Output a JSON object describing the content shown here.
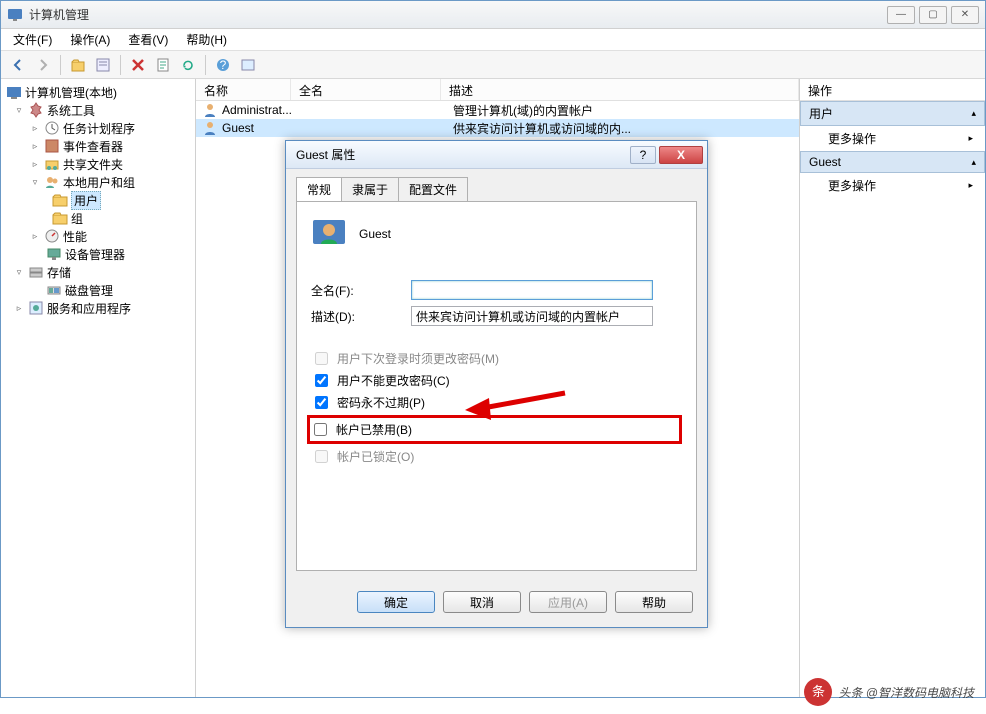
{
  "window": {
    "title": "计算机管理"
  },
  "menu": {
    "file": "文件(F)",
    "action": "操作(A)",
    "view": "查看(V)",
    "help": "帮助(H)"
  },
  "tree": {
    "root": "计算机管理(本地)",
    "sys": "系统工具",
    "sched": "任务计划程序",
    "event": "事件查看器",
    "share": "共享文件夹",
    "localusr": "本地用户和组",
    "users": "用户",
    "groups": "组",
    "perf": "性能",
    "devmgr": "设备管理器",
    "storage": "存储",
    "disk": "磁盘管理",
    "services": "服务和应用程序"
  },
  "list": {
    "hdr_name": "名称",
    "hdr_full": "全名",
    "hdr_desc": "描述",
    "r0_name": "Administrat...",
    "r0_desc": "管理计算机(域)的内置帐户",
    "r1_name": "Guest",
    "r1_desc": "供来宾访问计算机或访问域的内..."
  },
  "actions": {
    "title": "操作",
    "sec1": "用户",
    "more": "更多操作",
    "sec2": "Guest"
  },
  "dialog": {
    "title": "Guest 属性",
    "tab_general": "常规",
    "tab_member": "隶属于",
    "tab_profile": "配置文件",
    "username": "Guest",
    "lbl_fullname": "全名(F):",
    "val_fullname": "",
    "lbl_desc": "描述(D):",
    "val_desc": "供来宾访问计算机或访问域的内置帐户",
    "chk_mustchange": "用户下次登录时须更改密码(M)",
    "chk_cannotchange": "用户不能更改密码(C)",
    "chk_neverexpire": "密码永不过期(P)",
    "chk_disabled": "帐户已禁用(B)",
    "chk_locked": "帐户已锁定(O)",
    "btn_ok": "确定",
    "btn_cancel": "取消",
    "btn_apply": "应用(A)",
    "btn_help": "帮助"
  },
  "watermark": "头条 @智洋数码电脑科技"
}
